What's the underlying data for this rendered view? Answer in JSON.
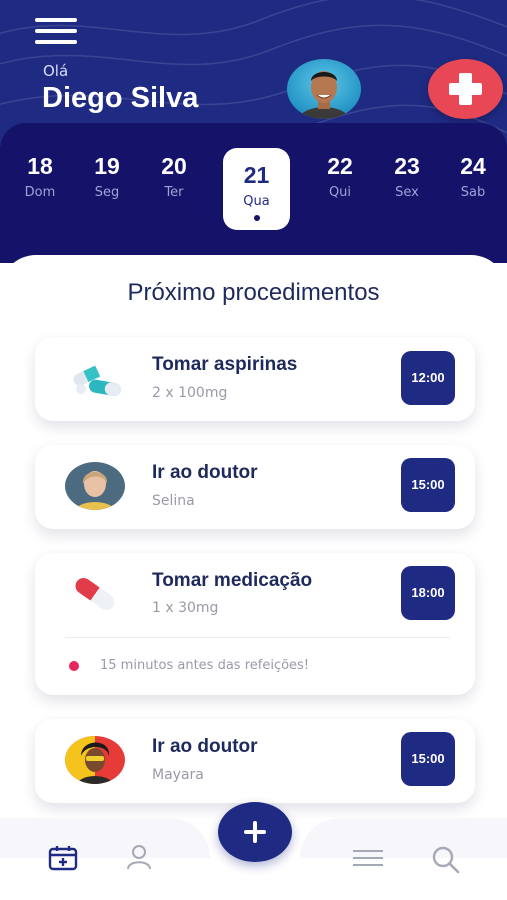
{
  "header": {
    "greeting": "Olá",
    "user_name": "Diego Silva",
    "menu_icon": "hamburger-menu-icon",
    "emergency_icon": "medical-cross-icon",
    "brand_color": "#1f2a83",
    "accent_color": "#e84855"
  },
  "calendar": {
    "days": [
      {
        "num": "18",
        "weekday": "Dom"
      },
      {
        "num": "19",
        "weekday": "Seg"
      },
      {
        "num": "20",
        "weekday": "Ter"
      },
      {
        "num": "21",
        "weekday": "Qua",
        "selected": true
      },
      {
        "num": "22",
        "weekday": "Qui"
      },
      {
        "num": "23",
        "weekday": "Sex"
      },
      {
        "num": "24",
        "weekday": "Sab"
      }
    ]
  },
  "procedures": {
    "title": "Próximo procedimentos",
    "items": [
      {
        "title": "Tomar aspirinas",
        "subtitle": "2 x 100mg",
        "time": "12:00",
        "icon": "pills-icon"
      },
      {
        "title": "Ir ao doutor",
        "subtitle": "Selina",
        "time": "15:00",
        "icon": "doctor-avatar"
      },
      {
        "title": "Tomar medicação",
        "subtitle": "1 x 30mg",
        "time": "18:00",
        "icon": "capsule-icon",
        "note": "15 minutos antes das refeições!"
      },
      {
        "title": "Ir ao doutor",
        "subtitle": "Mayara",
        "time": "15:00",
        "icon": "doctor-avatar"
      }
    ]
  },
  "bottom_nav": {
    "items": [
      "calendar-icon",
      "user-icon",
      "add-icon",
      "list-icon",
      "search-icon"
    ]
  }
}
